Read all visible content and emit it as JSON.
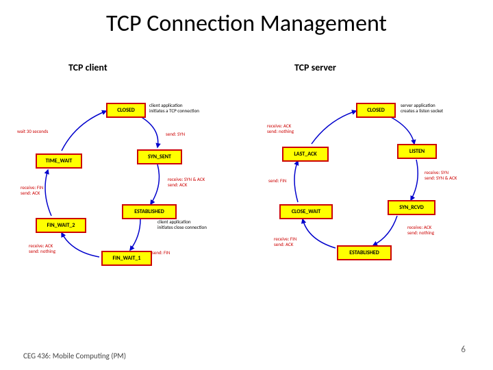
{
  "title": "TCP Connection Management",
  "subtitles": {
    "client": "TCP client",
    "server": "TCP server"
  },
  "footer": {
    "course": "CEG 436: Mobile Computing\n(PM)",
    "page": "6"
  },
  "client": {
    "states": {
      "closed": "CLOSED",
      "syn_sent": "SYN_SENT",
      "established": "ESTABLISHED",
      "fin_wait_1": "FIN_WAIT_1",
      "fin_wait_2": "FIN_WAIT_2",
      "time_wait": "TIME_WAIT"
    },
    "labels": {
      "start": "client application\ninitiates a TCP connection",
      "send_syn": "send: SYN",
      "recv_synack": "receive: SYN & ACK\nsend: ACK",
      "close": "client application\ninitiates close connection",
      "send_fin": "send: FIN",
      "recv_ack": "receive: ACK\nsend: nothing",
      "recv_fin": "receive: FIN\nsend: ACK",
      "wait30": "wait 30 seconds"
    }
  },
  "server": {
    "states": {
      "closed": "CLOSED",
      "listen": "LISTEN",
      "syn_rcvd": "SYN_RCVD",
      "established": "ESTABLISHED",
      "close_wait": "CLOSE_WAIT",
      "last_ack": "LAST_ACK"
    },
    "labels": {
      "create": "server application\ncreates a listen socket",
      "recv_syn": "receive: SYN\nsend: SYN & ACK",
      "recv_ack_est": "receive: ACK\nsend: nothing",
      "recv_fin": "receive: FIN\nsend: ACK",
      "send_fin": "send: FIN",
      "recv_ack_close": "receive: ACK\nsend: nothing"
    }
  }
}
